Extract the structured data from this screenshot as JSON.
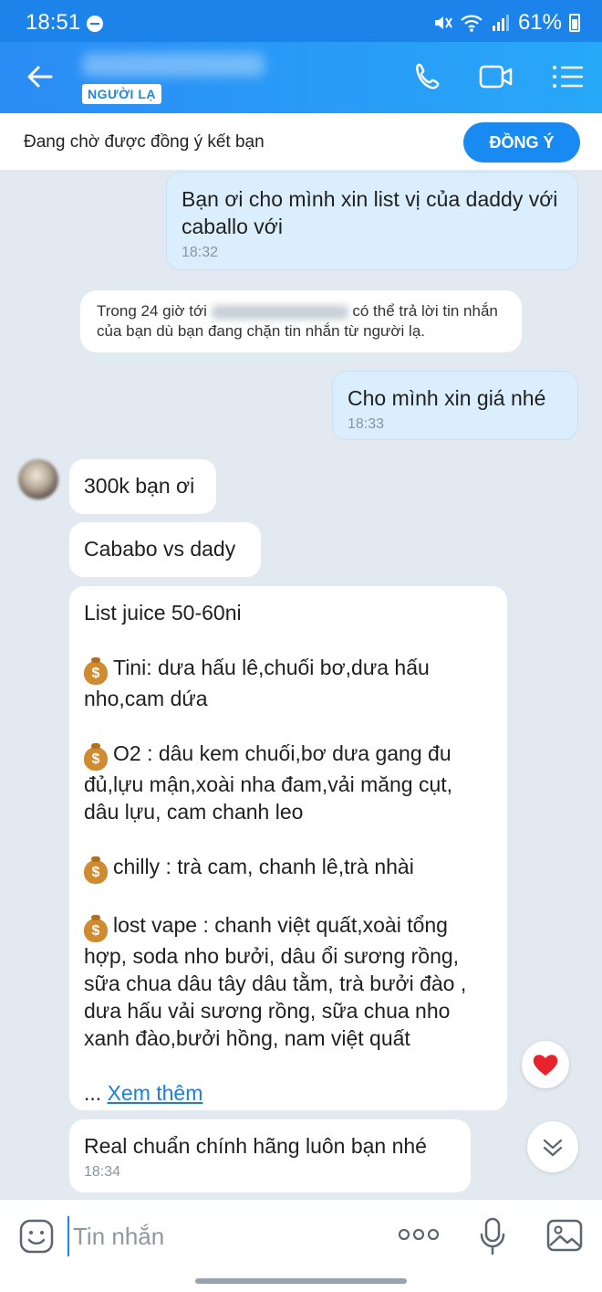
{
  "status_bar": {
    "time": "18:51",
    "battery": "61%"
  },
  "header": {
    "stranger_tag": "NGƯỜI LẠ"
  },
  "friend_request": {
    "text": "Đang chờ được đồng ý kết bạn",
    "accept_label": "ĐỒNG Ý"
  },
  "messages": {
    "m1": {
      "text": "Bạn ơi cho mình xin list vị của daddy với caballo với",
      "time": "18:32"
    },
    "system": {
      "before": "Trong 24 giờ tới",
      "after": "có thể trả lời tin nhắn của bạn dù bạn đang chặn tin nhắn từ người lạ."
    },
    "m2": {
      "text": "Cho mình xin giá nhé",
      "time": "18:33"
    },
    "m3": {
      "text": "300k bạn ơi"
    },
    "m4": {
      "text": "Cababo vs dady"
    },
    "m5": {
      "title": "List juice 50-60ni",
      "items": [
        "Tini: dưa hấu lê,chuối bơ,dưa hấu nho,cam dứa",
        "O2 : dâu kem chuối,bơ dưa gang đu đủ,lựu mận,xoài nha đam,vải măng cụt, dâu lựu, cam chanh leo",
        "chilly : trà cam, chanh lê,trà nhài",
        "lost vape : chanh việt quất,xoài tổng hợp, soda nho bưởi, dâu ổi sương rồng, sữa chua dâu tây dâu tằm, trà bưởi đào , dưa hấu vải sương rồng, sữa chua nho xanh đào,bưởi hồng, nam việt quất"
      ],
      "ellipsis": "...",
      "see_more": "Xem thêm"
    },
    "m6": {
      "text": "Real chuẩn chính hãng luôn bạn nhé",
      "time": "18:34"
    }
  },
  "input": {
    "placeholder": "Tin nhắn"
  },
  "colors": {
    "brand": "#1a8af3",
    "header_bg": "#2a8cf5",
    "out_bubble": "#dbeefd",
    "chat_bg": "#e2e9f1"
  }
}
